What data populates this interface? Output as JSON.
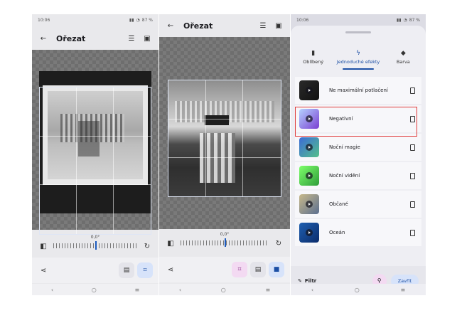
{
  "panel1": {
    "status_time": "10:06",
    "status_battery": "87 %",
    "title": "Ořezat",
    "rotation_label": "0,0°"
  },
  "panel2": {
    "title": "Ořezat",
    "rotation_label": "0,0°"
  },
  "panel3": {
    "status_time": "10:06",
    "status_battery": "87 %",
    "tabs": [
      {
        "label": "Oblíbený",
        "icon": "bookmark-icon"
      },
      {
        "label": "Jednoduché efekty",
        "icon": "bolt-icon"
      },
      {
        "label": "Barva",
        "icon": "paint-bucket-icon"
      }
    ],
    "active_tab": "Jednoduché efekty",
    "effects": [
      {
        "label": "Ne maximální potlačení",
        "colors": [
          "#2a2a2a",
          "#111111"
        ]
      },
      {
        "label": "Negativní",
        "colors": [
          "#b4d2ff",
          "#7a3fd1"
        ]
      },
      {
        "label": "Noční magie",
        "colors": [
          "#3b6bd6",
          "#54c08a"
        ]
      },
      {
        "label": "Noční vidění",
        "colors": [
          "#7dff6a",
          "#2f9d3a"
        ]
      },
      {
        "label": "Občané",
        "colors": [
          "#c8b98a",
          "#5b6e8f"
        ]
      },
      {
        "label": "Oceán",
        "colors": [
          "#1f5fb0",
          "#0c2c6b"
        ]
      }
    ],
    "highlighted_effect": "Negativní",
    "filter_label": "Filtr",
    "close_label": "Zavřít"
  },
  "colors": {
    "accent": "#1c4fa5",
    "highlight": "#e03a3a"
  }
}
